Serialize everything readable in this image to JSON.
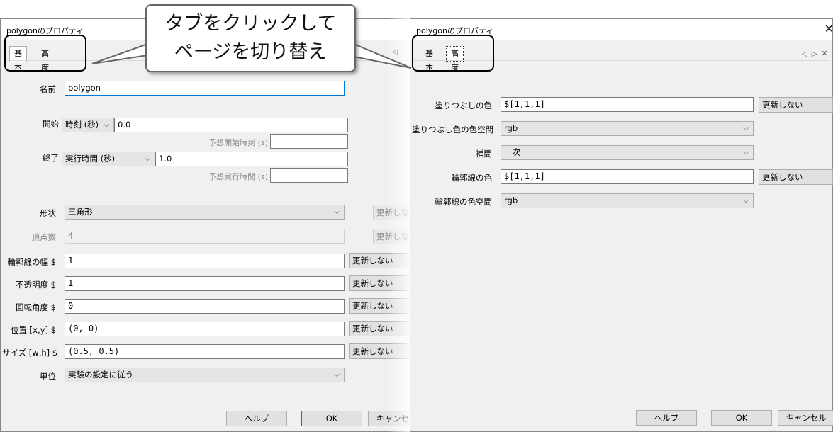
{
  "callout": {
    "line1": "タブをクリックして",
    "line2": "ページを切り替え"
  },
  "left_dialog": {
    "title": "polygonのプロパティ",
    "tabs": [
      "基本",
      "高度"
    ],
    "active_tab": "基本",
    "fields": {
      "name": {
        "label": "名前",
        "value": "polygon"
      },
      "start": {
        "label": "開始",
        "type": "時刻 (秒)",
        "value": "0.0",
        "expected_label": "予想開始時刻 (s)",
        "expected_value": ""
      },
      "stop": {
        "label": "終了",
        "type": "実行時間 (秒)",
        "value": "1.0",
        "expected_label": "予想実行時間 (s)",
        "expected_value": ""
      },
      "shape": {
        "label": "形状",
        "value": "三角形",
        "update": "更新しない"
      },
      "vertices": {
        "label": "頂点数",
        "value": "4",
        "update": "更新しな"
      },
      "line_width": {
        "label": "輪郭線の幅 $",
        "value": "1",
        "update": "更新しない"
      },
      "opacity": {
        "label": "不透明度 $",
        "value": "1",
        "update": "更新しない"
      },
      "orientation": {
        "label": "回転角度 $",
        "value": "0",
        "update": "更新しない"
      },
      "position": {
        "label": "位置 [x,y] $",
        "value": "(0, 0)",
        "update": "更新しない"
      },
      "size": {
        "label": "サイズ [w,h] $",
        "value": "(0.5, 0.5)",
        "update": "更新しない"
      },
      "units": {
        "label": "単位",
        "value": "実験の設定に従う"
      }
    },
    "buttons": {
      "help": "ヘルプ",
      "ok": "OK",
      "cancel": "キャンセ"
    }
  },
  "right_dialog": {
    "title": "polygonのプロパティ",
    "tabs": [
      "基本",
      "高度"
    ],
    "active_tab": "高度",
    "fields": {
      "fill_color": {
        "label": "塗りつぶしの色",
        "value": "$[1,1,1]",
        "update": "更新しない"
      },
      "fill_color_space": {
        "label": "塗りつぶし色の色空間",
        "value": "rgb"
      },
      "interpolate": {
        "label": "補間",
        "value": "一次"
      },
      "line_color": {
        "label": "輪郭線の色",
        "value": "$[1,1,1]",
        "update": "更新しない"
      },
      "line_color_space": {
        "label": "輪郭線の色空間",
        "value": "rgb"
      }
    },
    "buttons": {
      "help": "ヘルプ",
      "ok": "OK",
      "cancel": "キャンセル"
    }
  }
}
